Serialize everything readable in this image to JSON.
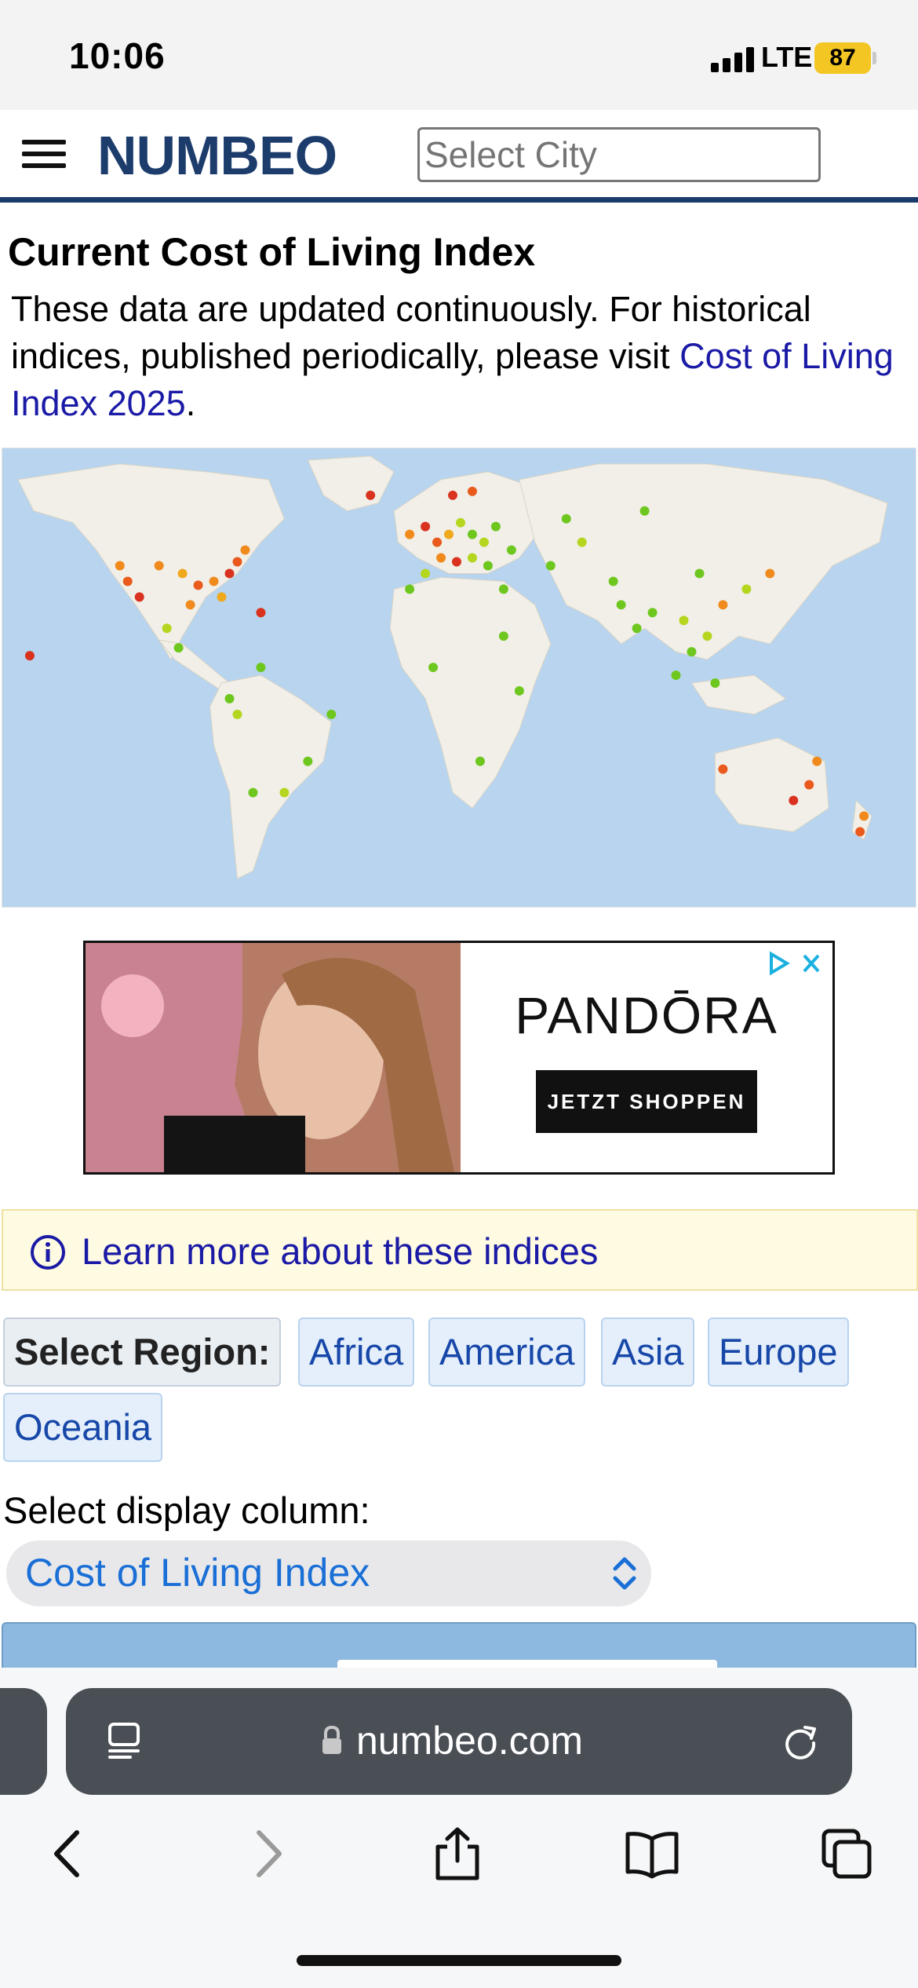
{
  "status_bar": {
    "time": "10:06",
    "network": "LTE",
    "battery": "87"
  },
  "header": {
    "logo": "NUMBEO",
    "city_placeholder": "Select City"
  },
  "page": {
    "title": "Current Cost of Living Index",
    "intro_text": "These data are updated continuously. For historical indices, published periodically, please visit ",
    "intro_link": "Cost of Living Index 2025",
    "intro_end": "."
  },
  "ad": {
    "brand": "PANDŌRA",
    "cta": "JETZT SHOPPEN"
  },
  "info": {
    "link": "Learn more about these indices"
  },
  "regions": {
    "label": "Select Region:",
    "items": [
      "Africa",
      "America",
      "Asia",
      "Europe",
      "Oceania"
    ]
  },
  "display": {
    "label": "Select display column:",
    "selected": "Cost of Living Index"
  },
  "browser": {
    "domain": "numbeo.com"
  },
  "colors": {
    "brand": "#1c3c6c",
    "link": "#1a1aa6",
    "select_text": "#1a6fd6",
    "marker_high": "#d9321f",
    "marker_mid": "#f08a1c",
    "marker_low": "#6ec71e"
  }
}
